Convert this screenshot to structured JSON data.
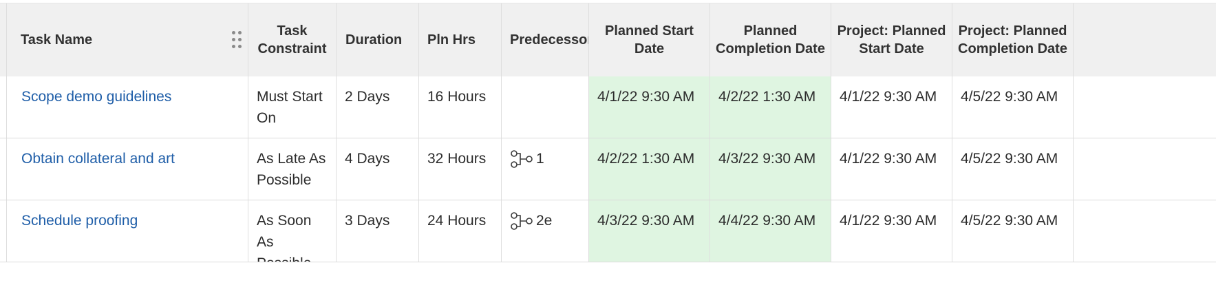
{
  "columns": {
    "task_name": "Task Name",
    "task_constraint": "Task Constraint",
    "duration": "Duration",
    "pln_hrs": "Pln Hrs",
    "predecessors": "Predecessors",
    "planned_start": "Planned Start Date",
    "planned_completion": "Planned Completion Date",
    "project_planned_start": "Project: Planned Start Date",
    "project_planned_completion": "Project: Planned Completion Date"
  },
  "rows": [
    {
      "task_name": "Scope demo guidelines",
      "task_constraint": "Must Start On",
      "duration": "2 Days",
      "pln_hrs": "16 Hours",
      "predecessors": "",
      "planned_start": "4/1/22 9:30 AM",
      "planned_completion": "4/2/22 1:30 AM",
      "project_planned_start": "4/1/22 9:30 AM",
      "project_planned_completion": "4/5/22 9:30 AM"
    },
    {
      "task_name": "Obtain collateral and art",
      "task_constraint": "As Late As Possible",
      "duration": "4 Days",
      "pln_hrs": "32 Hours",
      "predecessors": "1",
      "planned_start": "4/2/22 1:30 AM",
      "planned_completion": "4/3/22 9:30 AM",
      "project_planned_start": "4/1/22 9:30 AM",
      "project_planned_completion": "4/5/22 9:30 AM"
    },
    {
      "task_name": "Schedule proofing",
      "task_constraint": "As Soon As Possible",
      "duration": "3 Days",
      "pln_hrs": "24 Hours",
      "predecessors": "2e",
      "planned_start": "4/3/22 9:30 AM",
      "planned_completion": "4/4/22 9:30 AM",
      "project_planned_start": "4/1/22 9:30 AM",
      "project_planned_completion": "4/5/22 9:30 AM"
    }
  ],
  "icons": {
    "column_grip": "drag-handle-icon",
    "predecessor": "predecessor-link-icon"
  },
  "colors": {
    "header_bg": "#f0f0f0",
    "date_highlight": "#dff5e1",
    "link": "#1f5ea8"
  }
}
